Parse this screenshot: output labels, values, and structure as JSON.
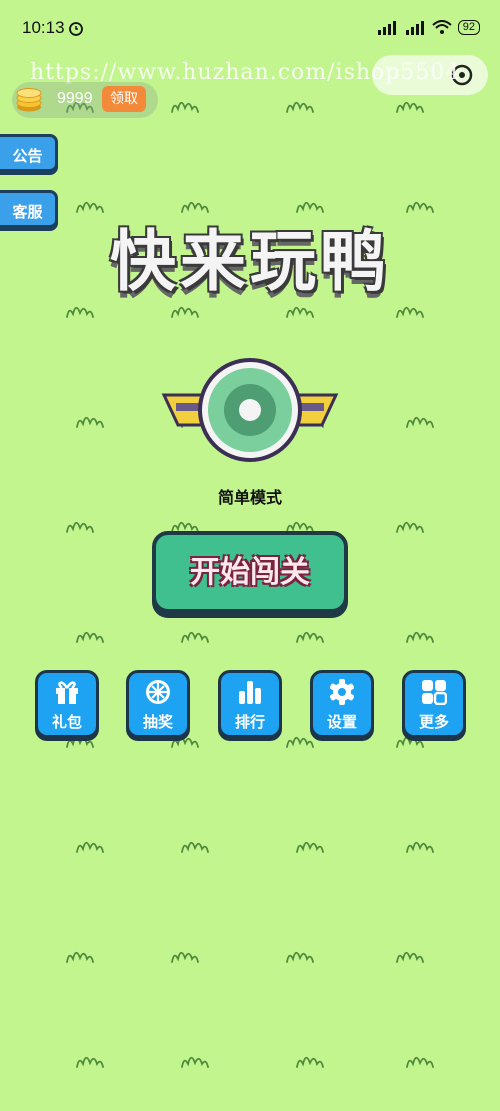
{
  "status_bar": {
    "time": "10:13",
    "battery": "92"
  },
  "watermark": "https://www.huzhan.com/ishop5504",
  "coins": {
    "value": "9999",
    "claim_label": "领取"
  },
  "side_buttons": {
    "notice": "公告",
    "service": "客服"
  },
  "title": "快来玩鸭",
  "mode": "简单模式",
  "start_label": "开始闯关",
  "menu": [
    {
      "label": "礼包",
      "icon": "gift-icon"
    },
    {
      "label": "抽奖",
      "icon": "wheel-icon"
    },
    {
      "label": "排行",
      "icon": "bar-chart-icon"
    },
    {
      "label": "设置",
      "icon": "gear-icon"
    },
    {
      "label": "更多",
      "icon": "grid-icon"
    }
  ],
  "colors": {
    "background": "#c2f58e",
    "start_button": "#3fc08e",
    "menu_button": "#1ea2f2",
    "claim_button": "#f38a3a"
  }
}
